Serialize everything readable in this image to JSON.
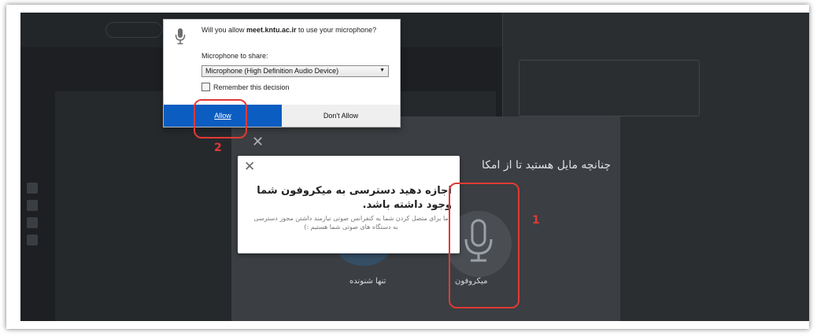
{
  "app": {
    "modal": {
      "title": "چنانچه مایل هستید تا از امکا",
      "options": [
        {
          "label": "میکروفون",
          "icon": "microphone-icon"
        },
        {
          "label": "تنها شنونده",
          "icon": "headphones-icon"
        }
      ]
    },
    "tooltip": {
      "title": "اجازه دهید دسترسی به میکروفون شما وجود داشته باشد.",
      "description": "ما برای متصل کردن شما به کنفرانس صوتی نیازمند داشتن مجوز دسترسی به دستگاه های صوتی شما هستیم :)"
    }
  },
  "permission_prompt": {
    "question_prefix": "Will you allow ",
    "domain": "meet.kntu.ac.ir",
    "question_suffix": " to use your microphone?",
    "share_label": "Microphone to share:",
    "selected_device": "Microphone (High Definition Audio Device)",
    "remember_label": "Remember this decision",
    "remember_checked": false,
    "allow_label": "Allow",
    "deny_label": "Don't Allow"
  },
  "annotations": {
    "step1": "1",
    "step2": "2"
  },
  "colors": {
    "highlight": "#e03a35",
    "allow_button": "#0b5dc2",
    "app_background": "#1d1f22"
  }
}
